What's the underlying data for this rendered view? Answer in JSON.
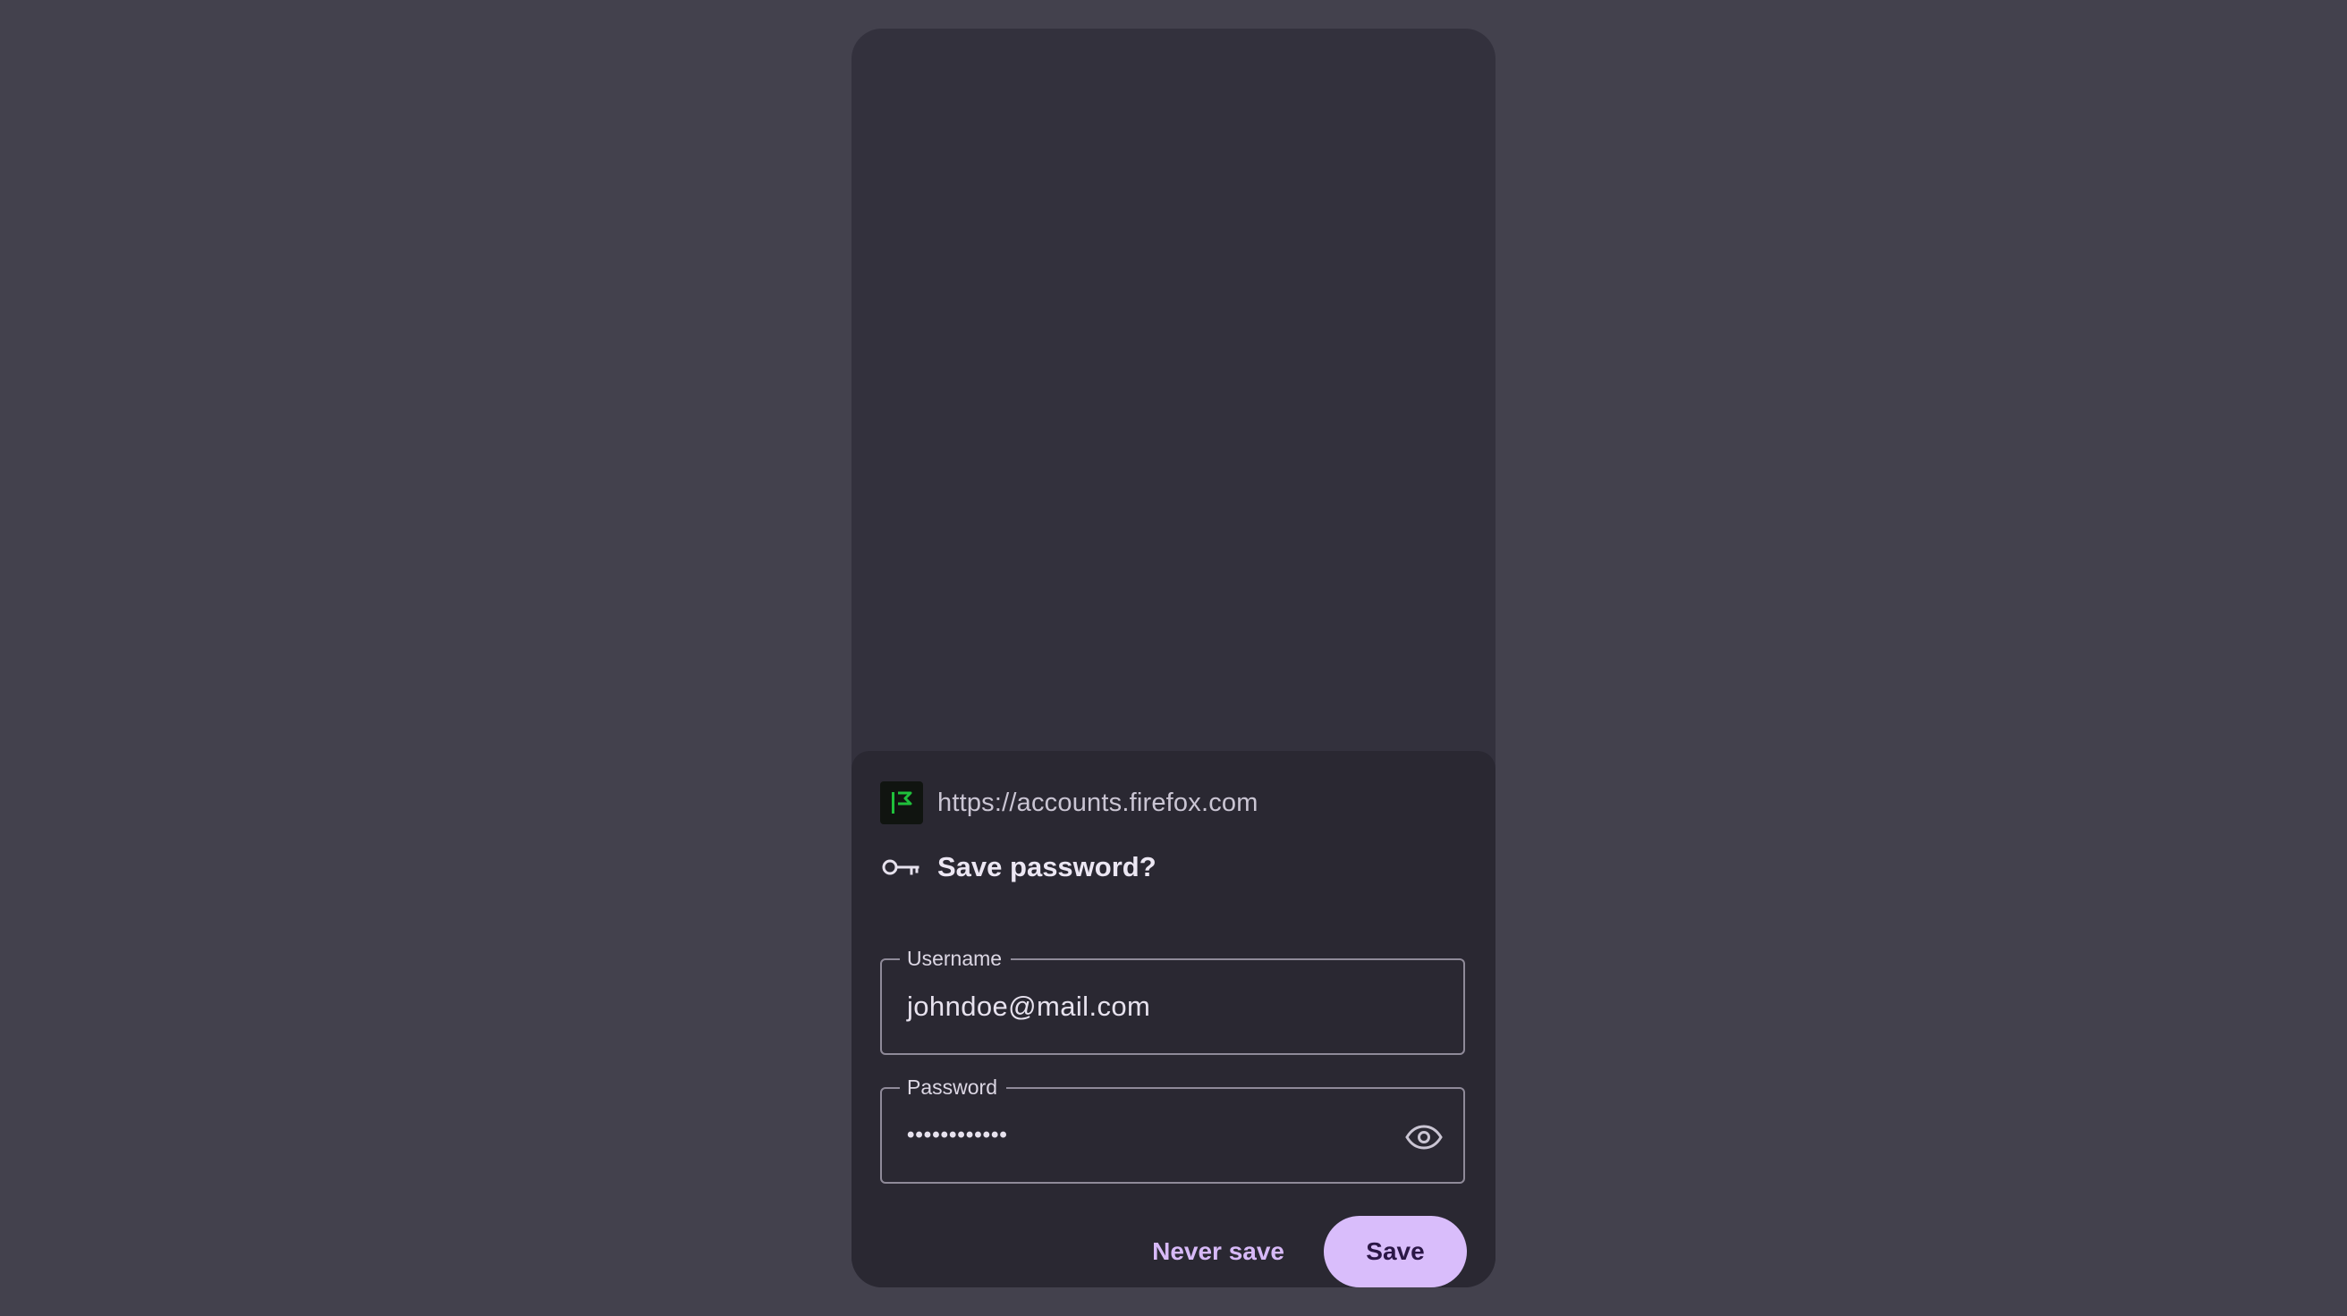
{
  "site": {
    "url": "https://accounts.firefox.com",
    "icon": "site-favicon-icon",
    "icon_color": "#1fbf3b"
  },
  "dialog": {
    "title": "Save password?",
    "icon": "key-icon"
  },
  "fields": {
    "username": {
      "label": "Username",
      "value": "johndoe@mail.com"
    },
    "password": {
      "label": "Password",
      "value": "••••••••••••",
      "toggle_icon": "eye-icon"
    }
  },
  "actions": {
    "never_save_label": "Never save",
    "save_label": "Save"
  },
  "colors": {
    "background": "#43414d",
    "surface": "#33313d",
    "sheet": "#2a2832",
    "accent": "#d9bdfb"
  }
}
